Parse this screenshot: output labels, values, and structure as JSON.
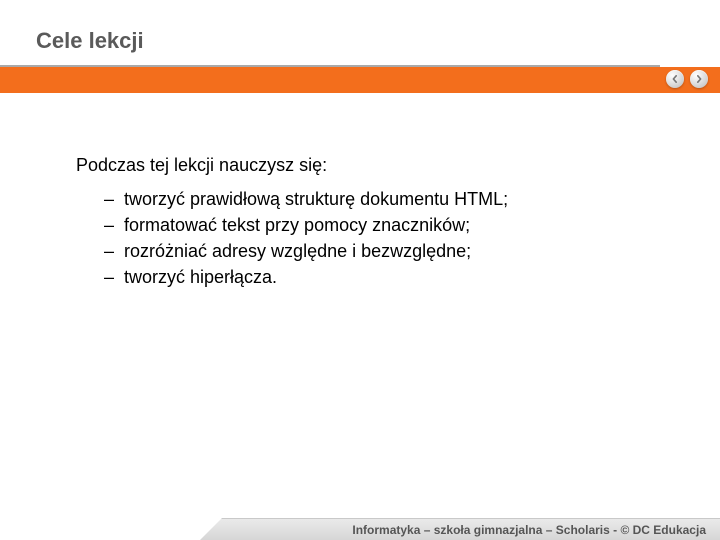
{
  "title": "Cele lekcji",
  "intro": "Podczas tej lekcji nauczysz się:",
  "bullets": [
    "tworzyć prawidłową strukturę dokumentu HTML;",
    "formatować tekst przy pomocy znaczników;",
    "rozróżniać adresy względne i bezwzględne;",
    "tworzyć hiperłącza."
  ],
  "footer": "Informatyka – szkoła gimnazjalna – Scholaris - © DC Edukacja",
  "nav": {
    "prev_icon": "chevron-left-icon",
    "next_icon": "chevron-right-icon"
  }
}
